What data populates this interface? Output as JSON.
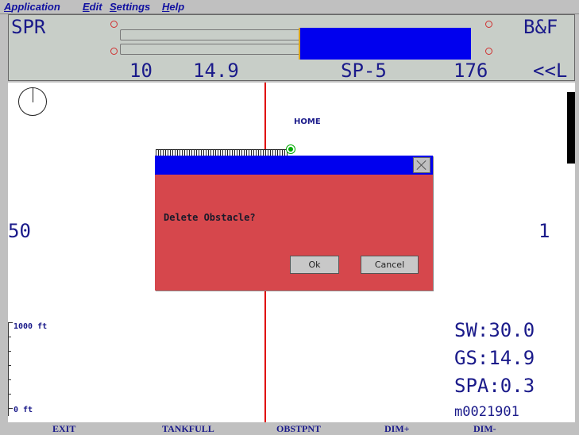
{
  "menu": {
    "application": "Application",
    "edit": "Edit",
    "settings": "Settings",
    "help": "Help"
  },
  "status": {
    "left_code": "SPR",
    "right_code": "B&F",
    "value_1": "10",
    "value_2": "14.9",
    "waypoint": "SP-5",
    "heading": "176",
    "direction": "<<L",
    "bar_color": "#0000ee"
  },
  "map": {
    "home_label": "HOME",
    "left_value": "50",
    "right_value": "1",
    "alt_top": "1000 ft",
    "alt_bottom": "0 ft",
    "readout_sw": "SW:30.0",
    "readout_gs": "GS:14.9",
    "readout_spa": "SPA:0.3",
    "id": "m0021901"
  },
  "dialog": {
    "message": "Delete Obstacle?",
    "ok_label": "Ok",
    "cancel_label": "Cancel",
    "background": "#d6474c",
    "titlebar_color": "#0000ee"
  },
  "fkeys": [
    "EXIT",
    "TANKFULL",
    "OBSTPNT",
    "DIM+",
    "DIM-"
  ]
}
